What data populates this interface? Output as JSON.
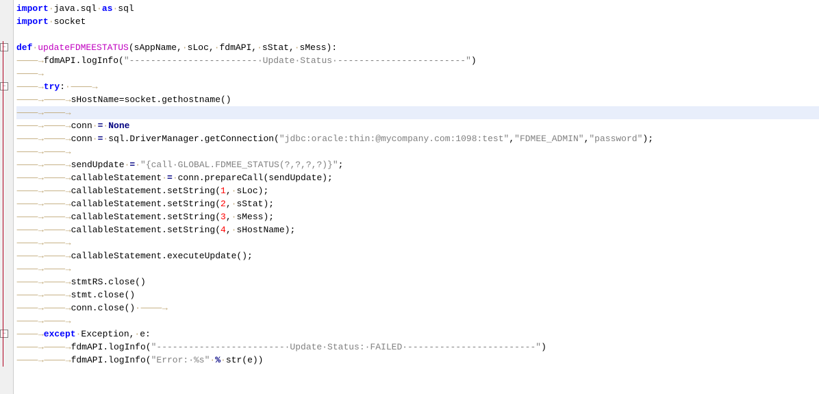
{
  "lines": [
    {
      "type": "code",
      "highlight": false,
      "tokens": [
        {
          "t": "import",
          "c": "kw"
        },
        {
          "t": "·",
          "c": "ws"
        },
        {
          "t": "java.sql",
          "c": "plain"
        },
        {
          "t": "·",
          "c": "ws"
        },
        {
          "t": "as",
          "c": "kw"
        },
        {
          "t": "·",
          "c": "ws"
        },
        {
          "t": "sql",
          "c": "plain"
        }
      ]
    },
    {
      "type": "code",
      "highlight": false,
      "tokens": [
        {
          "t": "import",
          "c": "kw"
        },
        {
          "t": "·",
          "c": "ws"
        },
        {
          "t": "socket",
          "c": "plain"
        }
      ]
    },
    {
      "type": "blank",
      "highlight": false
    },
    {
      "type": "code",
      "highlight": false,
      "fold": "minus",
      "tokens": [
        {
          "t": "def",
          "c": "kw"
        },
        {
          "t": "·",
          "c": "ws"
        },
        {
          "t": "updateFDMEESTATUS",
          "c": "defname"
        },
        {
          "t": "(sAppName,",
          "c": "plain"
        },
        {
          "t": "·",
          "c": "ws"
        },
        {
          "t": "sLoc,",
          "c": "plain"
        },
        {
          "t": "·",
          "c": "ws"
        },
        {
          "t": "fdmAPI,",
          "c": "plain"
        },
        {
          "t": "·",
          "c": "ws"
        },
        {
          "t": "sStat,",
          "c": "plain"
        },
        {
          "t": "·",
          "c": "ws"
        },
        {
          "t": "sMess):",
          "c": "plain"
        }
      ]
    },
    {
      "type": "code",
      "highlight": false,
      "indent": 1,
      "tokens": [
        {
          "t": "fdmAPI.logInfo(",
          "c": "plain"
        },
        {
          "t": "\"------------------------·Update·Status·------------------------\"",
          "c": "str"
        },
        {
          "t": ")",
          "c": "plain"
        }
      ]
    },
    {
      "type": "indent-only",
      "highlight": false,
      "indent": 1
    },
    {
      "type": "code",
      "highlight": false,
      "fold": "minus-red",
      "indent": 1,
      "trail": true,
      "tokens": [
        {
          "t": "try",
          "c": "kw"
        },
        {
          "t": ":",
          "c": "plain"
        }
      ]
    },
    {
      "type": "code",
      "highlight": false,
      "indent": 2,
      "tokens": [
        {
          "t": "sHostName=socket.gethostname()",
          "c": "plain"
        }
      ]
    },
    {
      "type": "indent-only",
      "highlight": true,
      "indent": 2
    },
    {
      "type": "code",
      "highlight": false,
      "indent": 2,
      "tokens": [
        {
          "t": "conn",
          "c": "plain"
        },
        {
          "t": "·",
          "c": "ws"
        },
        {
          "t": "=",
          "c": "op"
        },
        {
          "t": "·",
          "c": "ws"
        },
        {
          "t": "None",
          "c": "builtin"
        }
      ]
    },
    {
      "type": "code",
      "highlight": false,
      "indent": 2,
      "tokens": [
        {
          "t": "conn",
          "c": "plain"
        },
        {
          "t": "·",
          "c": "ws"
        },
        {
          "t": "=",
          "c": "op"
        },
        {
          "t": "·",
          "c": "ws"
        },
        {
          "t": "sql.DriverManager.getConnection(",
          "c": "plain"
        },
        {
          "t": "\"jdbc:oracle:thin:@mycompany.com:1098:test\"",
          "c": "str"
        },
        {
          "t": ",",
          "c": "plain"
        },
        {
          "t": "\"FDMEE_ADMIN\"",
          "c": "str"
        },
        {
          "t": ",",
          "c": "plain"
        },
        {
          "t": "\"password\"",
          "c": "str"
        },
        {
          "t": ");",
          "c": "plain"
        }
      ]
    },
    {
      "type": "indent-only",
      "highlight": false,
      "indent": 2
    },
    {
      "type": "code",
      "highlight": false,
      "indent": 2,
      "tokens": [
        {
          "t": "sendUpdate",
          "c": "plain"
        },
        {
          "t": "·",
          "c": "ws"
        },
        {
          "t": "=",
          "c": "op"
        },
        {
          "t": "·",
          "c": "ws"
        },
        {
          "t": "\"{call·GLOBAL.FDMEE_STATUS(?,?,?,?)}\"",
          "c": "str"
        },
        {
          "t": ";",
          "c": "plain"
        }
      ]
    },
    {
      "type": "code",
      "highlight": false,
      "indent": 2,
      "tokens": [
        {
          "t": "callableStatement",
          "c": "plain"
        },
        {
          "t": "·",
          "c": "ws"
        },
        {
          "t": "=",
          "c": "op"
        },
        {
          "t": "·",
          "c": "ws"
        },
        {
          "t": "conn.prepareCall(sendUpdate);",
          "c": "plain"
        }
      ]
    },
    {
      "type": "code",
      "highlight": false,
      "indent": 2,
      "tokens": [
        {
          "t": "callableStatement.setString(",
          "c": "plain"
        },
        {
          "t": "1",
          "c": "num"
        },
        {
          "t": ",",
          "c": "plain"
        },
        {
          "t": "·",
          "c": "ws"
        },
        {
          "t": "sLoc);",
          "c": "plain"
        }
      ]
    },
    {
      "type": "code",
      "highlight": false,
      "indent": 2,
      "tokens": [
        {
          "t": "callableStatement.setString(",
          "c": "plain"
        },
        {
          "t": "2",
          "c": "num"
        },
        {
          "t": ",",
          "c": "plain"
        },
        {
          "t": "·",
          "c": "ws"
        },
        {
          "t": "sStat);",
          "c": "plain"
        }
      ]
    },
    {
      "type": "code",
      "highlight": false,
      "indent": 2,
      "tokens": [
        {
          "t": "callableStatement.setString(",
          "c": "plain"
        },
        {
          "t": "3",
          "c": "num"
        },
        {
          "t": ",",
          "c": "plain"
        },
        {
          "t": "·",
          "c": "ws"
        },
        {
          "t": "sMess);",
          "c": "plain"
        }
      ]
    },
    {
      "type": "code",
      "highlight": false,
      "indent": 2,
      "tokens": [
        {
          "t": "callableStatement.setString(",
          "c": "plain"
        },
        {
          "t": "4",
          "c": "num"
        },
        {
          "t": ",",
          "c": "plain"
        },
        {
          "t": "·",
          "c": "ws"
        },
        {
          "t": "sHostName);",
          "c": "plain"
        }
      ]
    },
    {
      "type": "indent-only",
      "highlight": false,
      "indent": 2
    },
    {
      "type": "code",
      "highlight": false,
      "indent": 2,
      "tokens": [
        {
          "t": "callableStatement.executeUpdate();",
          "c": "plain"
        }
      ]
    },
    {
      "type": "indent-only",
      "highlight": false,
      "indent": 2
    },
    {
      "type": "code",
      "highlight": false,
      "indent": 2,
      "tokens": [
        {
          "t": "stmtRS.close()",
          "c": "plain"
        }
      ]
    },
    {
      "type": "code",
      "highlight": false,
      "indent": 2,
      "tokens": [
        {
          "t": "stmt.close()",
          "c": "plain"
        }
      ]
    },
    {
      "type": "code",
      "highlight": false,
      "indent": 2,
      "trail": true,
      "tokens": [
        {
          "t": "conn.close()",
          "c": "plain"
        }
      ]
    },
    {
      "type": "indent-only",
      "highlight": false,
      "indent": 2
    },
    {
      "type": "code",
      "highlight": false,
      "fold": "minus",
      "indent": 1,
      "tokens": [
        {
          "t": "except",
          "c": "kw"
        },
        {
          "t": "·",
          "c": "ws"
        },
        {
          "t": "Exception,",
          "c": "plain"
        },
        {
          "t": "·",
          "c": "ws"
        },
        {
          "t": "e:",
          "c": "plain"
        }
      ]
    },
    {
      "type": "code",
      "highlight": false,
      "indent": 2,
      "tokens": [
        {
          "t": "fdmAPI.logInfo(",
          "c": "plain"
        },
        {
          "t": "\"------------------------·Update·Status:·FAILED·------------------------\"",
          "c": "str"
        },
        {
          "t": ")",
          "c": "plain"
        }
      ]
    },
    {
      "type": "code",
      "highlight": false,
      "indent": 2,
      "tokens": [
        {
          "t": "fdmAPI.logInfo(",
          "c": "plain"
        },
        {
          "t": "\"Error:·%s\"",
          "c": "str"
        },
        {
          "t": "·",
          "c": "ws"
        },
        {
          "t": "%",
          "c": "op"
        },
        {
          "t": "·",
          "c": "ws"
        },
        {
          "t": "str(e))",
          "c": "plain"
        }
      ]
    }
  ],
  "tab_glyph": "⸻→",
  "dot_glyph": "·"
}
